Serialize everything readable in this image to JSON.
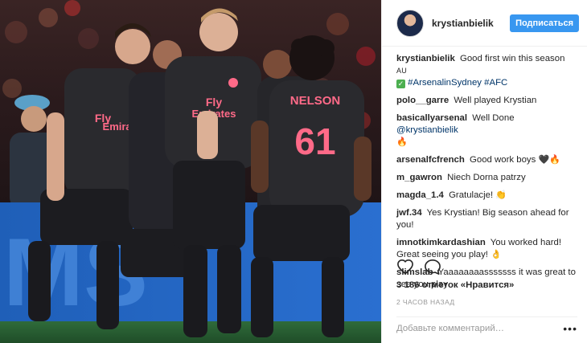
{
  "post": {
    "username": "krystianbielik",
    "follow_label": "Подписаться",
    "photo": {
      "board_text": "MS",
      "shirt_sponsor_line1": "Fly",
      "shirt_sponsor_line2": "Emirates",
      "player_name": "NELSON",
      "player_number": "61"
    }
  },
  "caption": {
    "user": "krystianbielik",
    "text": "Good first win this season",
    "flag": "AU",
    "hashtag1": "#ArsenalinSydney",
    "hashtag2": "#AFC"
  },
  "comments": [
    {
      "user": "polo__garre",
      "text": "Well played Krystian"
    },
    {
      "user": "basicallyarsenal",
      "text": "Well Done",
      "mention": "@krystianbielik",
      "emoji": "🔥"
    },
    {
      "user": "arsenalfcfrench",
      "text": "Good work boys",
      "emoji": "🖤🔥"
    },
    {
      "user": "m_gawron",
      "text": "Niech Dorna patrzy"
    },
    {
      "user": "magda_1.4",
      "text": "Gratulacje!",
      "emoji": "👏"
    },
    {
      "user": "jwf.34",
      "text": "Yes Krystian! Big season ahead for you!"
    },
    {
      "user": "imnotkimkardashian",
      "text": "You worked hard! Great seeing you play!",
      "emoji": "👌"
    },
    {
      "user": "slimslab",
      "text": "Yaaaaaaaasssssss it was great to see you play"
    }
  ],
  "stats": {
    "likes_label": "3 186 отметок «Нравится»",
    "time_label": "2 часов назад"
  },
  "input": {
    "placeholder": "Добавьте комментарий…",
    "more_label": "•••"
  },
  "colors": {
    "accent": "#3897f0",
    "text": "#262626",
    "muted": "#999999",
    "kit_dark": "#2a2a2e",
    "kit_pink": "#ff6a88"
  },
  "icons": {
    "like": "heart-outline-icon",
    "comment": "speech-bubble-icon"
  }
}
